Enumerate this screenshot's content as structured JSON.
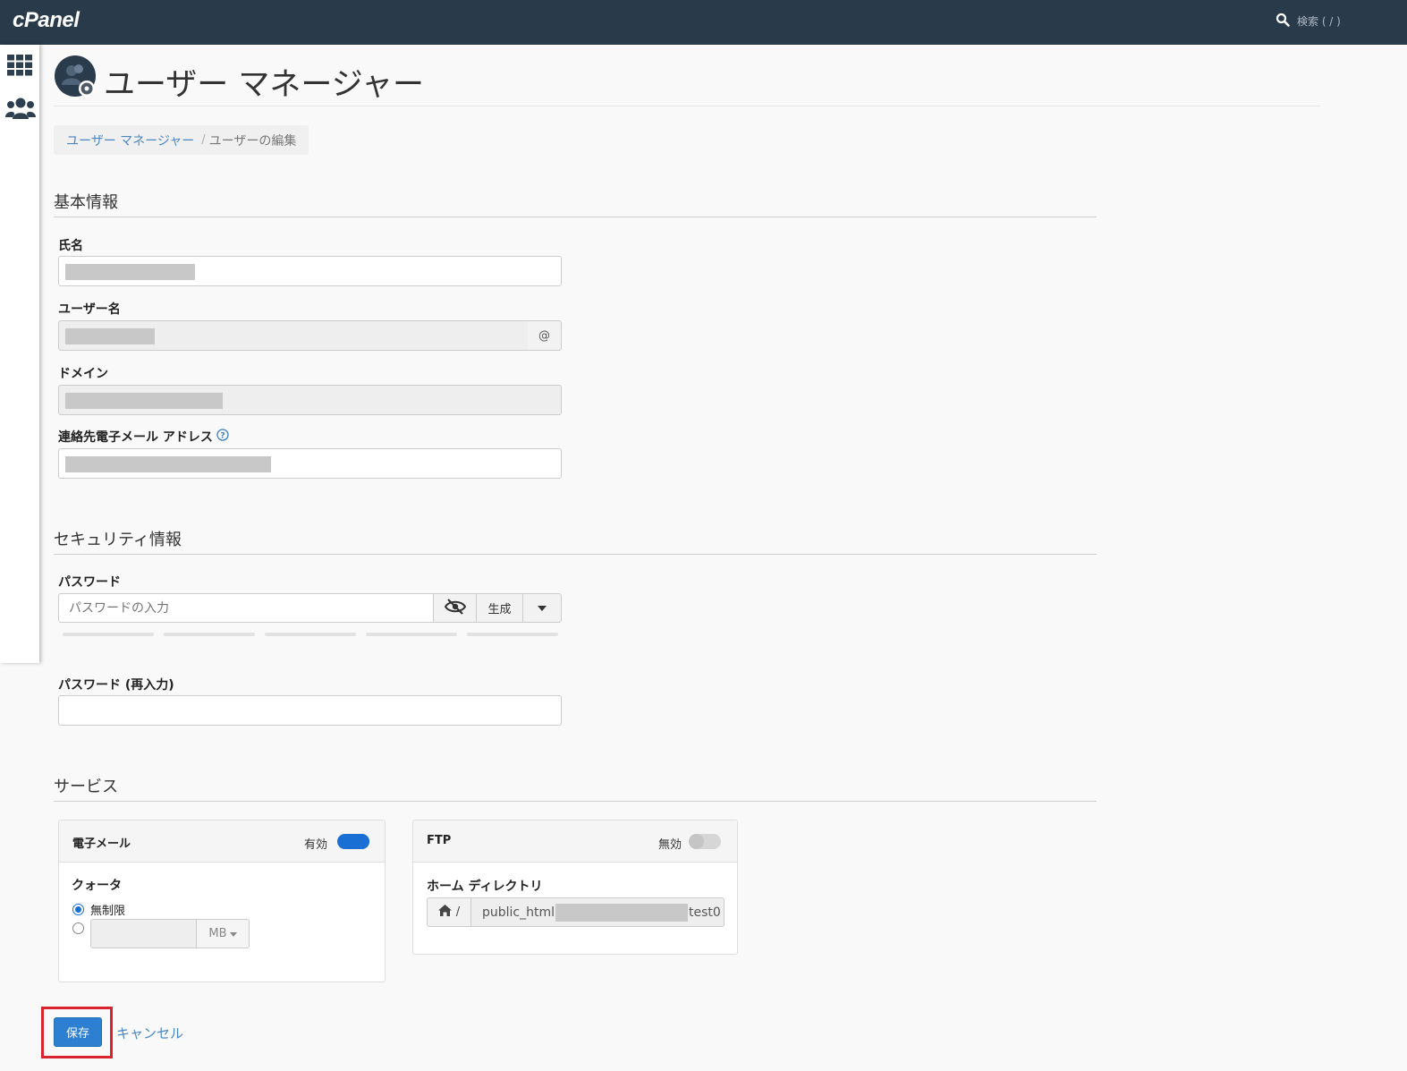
{
  "header": {
    "logo": "cPanel",
    "search_placeholder": "検索 ( / )"
  },
  "rail": {
    "icons": [
      "grid-icon",
      "users-icon"
    ]
  },
  "page": {
    "title": "ユーザー マネージャー",
    "icon": "user-manager-icon"
  },
  "breadcrumb": {
    "parent": "ユーザー マネージャー",
    "separator": "/",
    "current": "ユーザーの編集"
  },
  "basic": {
    "section_title": "基本情報",
    "full_name_label": "氏名",
    "username_label": "ユーザー名",
    "username_addon": "@",
    "domain_label": "ドメイン",
    "contact_email_label": "連絡先電子メール アドレス"
  },
  "security": {
    "section_title": "セキュリティ情報",
    "password_label": "パスワード",
    "password_placeholder": "パスワードの入力",
    "generate_label": "生成",
    "password_confirm_label": "パスワード (再入力)"
  },
  "services": {
    "section_title": "サービス",
    "email": {
      "title": "電子メール",
      "status": "有効",
      "enabled": true,
      "quota_label": "クォータ",
      "unlimited_label": "無制限",
      "unit": "MB"
    },
    "ftp": {
      "title": "FTP",
      "status": "無効",
      "enabled": false,
      "home_label": "ホーム ディレクトリ",
      "home_prefix": "/",
      "home_path_start": "public_html",
      "home_path_end": "test0"
    }
  },
  "actions": {
    "save": "保存",
    "cancel": "キャンセル"
  },
  "colors": {
    "topbar": "#293a4a",
    "accent": "#2d7fd1",
    "link": "#4a86c5",
    "highlight": "#d9232e"
  }
}
